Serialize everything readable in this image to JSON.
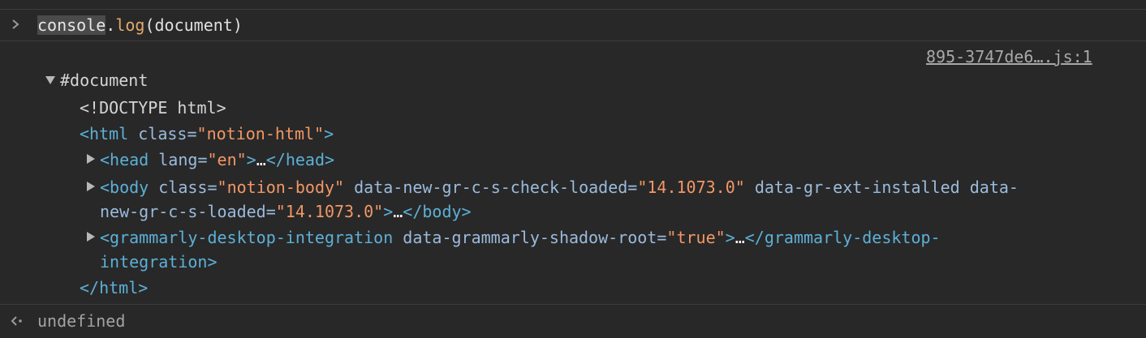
{
  "console": {
    "command": {
      "object": "console",
      "dot": ".",
      "method": "log",
      "open_paren": "(",
      "argument": "document",
      "close_paren": ")"
    },
    "source_link": "895-3747de6….js:1",
    "tree": {
      "root": "#document",
      "doctype": "<!DOCTYPE html>",
      "html_open": {
        "open": "<html",
        "attr": "class",
        "eq": "=",
        "value": "\"notion-html\"",
        "close": ">"
      },
      "head": {
        "open": "<head",
        "attr": "lang",
        "eq": "=",
        "value": "\"en\"",
        "gt": ">",
        "ellipsis": "…",
        "close": "</head>"
      },
      "body": {
        "open": "<body",
        "attr1": "class",
        "value1": "\"notion-body\"",
        "attr2": "data-new-gr-c-s-check-loaded",
        "value2": "\"14.1073.0\"",
        "attr3": "data-gr-ext-installed",
        "attr4_part1": "data-",
        "attr4_part2": "new-gr-c-s-loaded",
        "value4": "\"14.1073.0\"",
        "eq": "=",
        "gt": ">",
        "ellipsis": "…",
        "close": "</body>"
      },
      "grammarly": {
        "open": "<grammarly-desktop-integration",
        "attr": "data-grammarly-shadow-root",
        "eq": "=",
        "value": "\"true\"",
        "gt": ">",
        "ellipsis": "…",
        "close_part1": "</grammarly-desktop-",
        "close_part2": "integration>"
      },
      "html_close": "</html>"
    },
    "result": "undefined"
  },
  "colors": {
    "background": "#282828",
    "tag": "#5db0d7",
    "attribute": "#9bbbdc",
    "value": "#f29766",
    "method": "#e3a86f"
  },
  "icons": {
    "prompt": "chevron-right-icon",
    "result": "return-arrow-icon",
    "expand": "triangle-icon"
  }
}
